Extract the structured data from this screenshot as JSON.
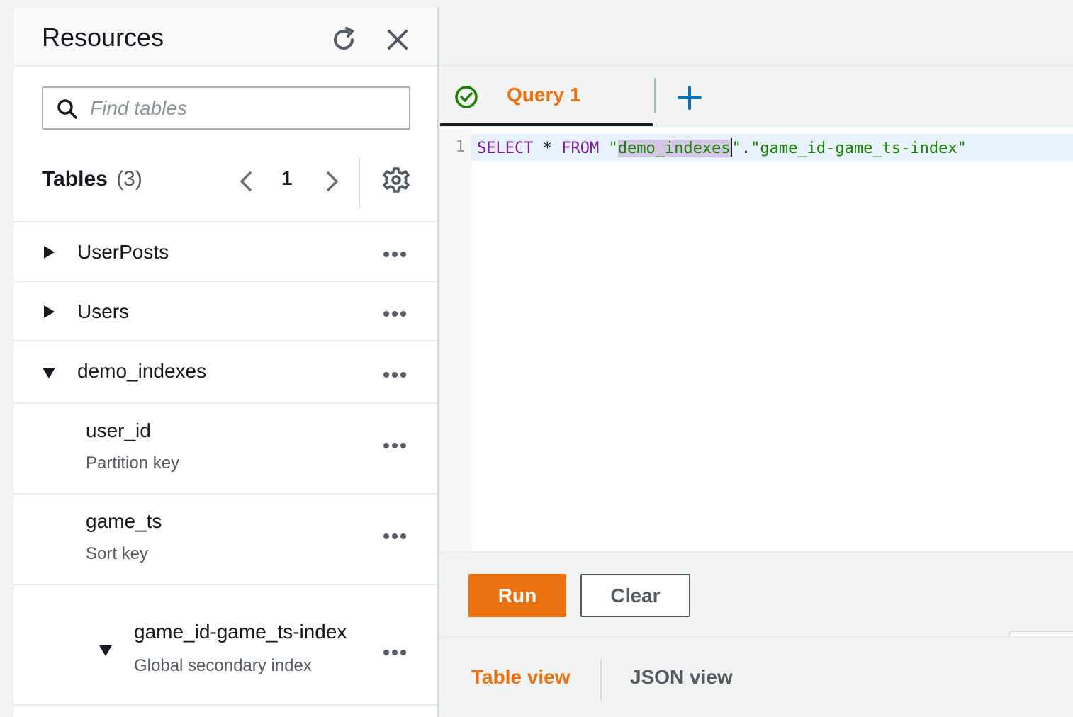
{
  "resources": {
    "title": "Resources",
    "search_placeholder": "Find tables",
    "tables_title": "Tables",
    "tables_count": "(3)",
    "page": "1"
  },
  "tables": [
    {
      "name": "UserPosts",
      "expanded": false
    },
    {
      "name": "Users",
      "expanded": false
    },
    {
      "name": "demo_indexes",
      "expanded": true
    }
  ],
  "attributes": [
    {
      "name": "user_id",
      "type": "Partition key"
    },
    {
      "name": "game_ts",
      "type": "Sort key"
    }
  ],
  "indexes": [
    {
      "name": "game_id-game_ts-index",
      "type": "Global secondary index",
      "expanded": true
    }
  ],
  "editor": {
    "tab_label": "Query 1",
    "line_number": "1",
    "tokens": {
      "select": "SELECT",
      "star": "*",
      "from": "FROM",
      "q1": "\"",
      "table": "demo_indexes",
      "q2": "\"",
      "dot": ".",
      "q3": "\"",
      "index": "game_id-game_ts-index",
      "q4": "\""
    }
  },
  "actions": {
    "run_label": "Run",
    "clear_label": "Clear"
  },
  "results": {
    "table_view_label": "Table view",
    "json_view_label": "JSON view"
  },
  "colors": {
    "accent": "#ec7211",
    "keyword": "#7d1fa3",
    "string": "#1d8102",
    "success": "#1d8102",
    "link_blue": "#0073bb"
  }
}
